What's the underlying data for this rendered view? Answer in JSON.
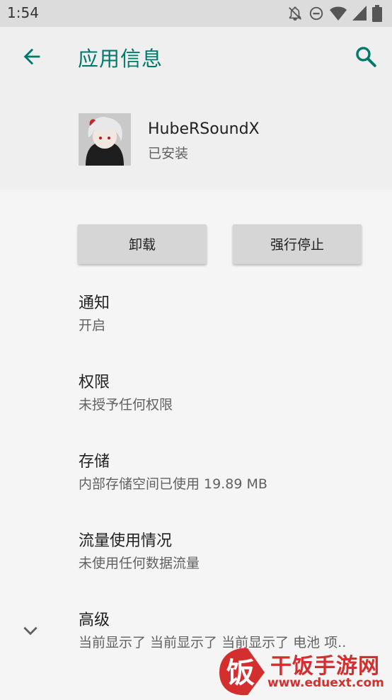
{
  "status_bar": {
    "time": "1:54",
    "icons": [
      "notifications-off-icon",
      "do-not-disturb-icon",
      "wifi-icon",
      "cellular-signal-icon",
      "battery-icon"
    ]
  },
  "app_bar": {
    "title": "应用信息",
    "back_icon": "arrow-back-icon",
    "search_icon": "search-icon"
  },
  "app": {
    "name": "HubeRSoundX",
    "status": "已安装"
  },
  "buttons": {
    "uninstall": "卸载",
    "force_stop": "强行停止"
  },
  "items": [
    {
      "title": "通知",
      "subtitle": "开启"
    },
    {
      "title": "权限",
      "subtitle": "未授予任何权限"
    },
    {
      "title": "存储",
      "subtitle": "内部存储空间已使用 19.89 MB"
    },
    {
      "title": "流量使用情况",
      "subtitle": "未使用任何数据流量"
    },
    {
      "title": "高级",
      "subtitle": "当前显示了 当前显示了 当前显示了 电池 项.."
    }
  ],
  "watermark": {
    "logo_char": "饭",
    "name": "干饭手游网",
    "url": "www.eduext.com"
  },
  "colors": {
    "accent": "#00796b",
    "status_bar_bg": "#dcdcdc",
    "header_bg": "#efefef",
    "button_bg": "#d6d6d6",
    "watermark": "#d32f2f"
  }
}
